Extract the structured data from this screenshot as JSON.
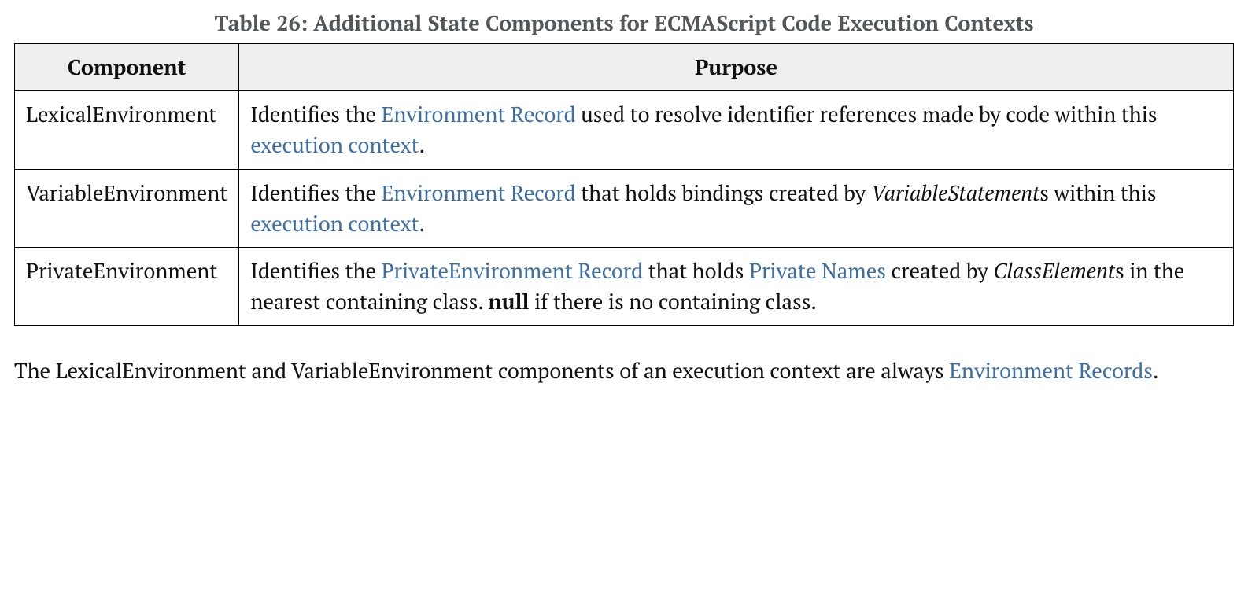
{
  "caption": "Table 26: Additional State Components for ECMAScript Code Execution Contexts",
  "headers": {
    "col1": "Component",
    "col2": "Purpose"
  },
  "rows": {
    "r1": {
      "component": "LexicalEnvironment",
      "p_a": "Identifies the ",
      "p_link1": "Environment Record",
      "p_b": " used to resolve identifier references made by code within this ",
      "p_link2": "execution context",
      "p_c": "."
    },
    "r2": {
      "component": "VariableEnvironment",
      "p_a": "Identifies the ",
      "p_link1": "Environment Record",
      "p_b": " that holds bindings created by ",
      "p_ital": "VariableStatement",
      "p_c": "s within this ",
      "p_link2": "execution context",
      "p_d": "."
    },
    "r3": {
      "component": "PrivateEnvironment",
      "p_a": "Identifies the ",
      "p_link1": "PrivateEnvironment Record",
      "p_b": " that holds ",
      "p_link2": "Private Names",
      "p_c": " created by ",
      "p_ital": "ClassElement",
      "p_d": "s in the nearest containing class. ",
      "p_bold": "null",
      "p_e": " if there is no containing class."
    }
  },
  "after": {
    "a": "The LexicalEnvironment and VariableEnvironment components of an execution context are always ",
    "link": "Environment Records",
    "b": "."
  }
}
